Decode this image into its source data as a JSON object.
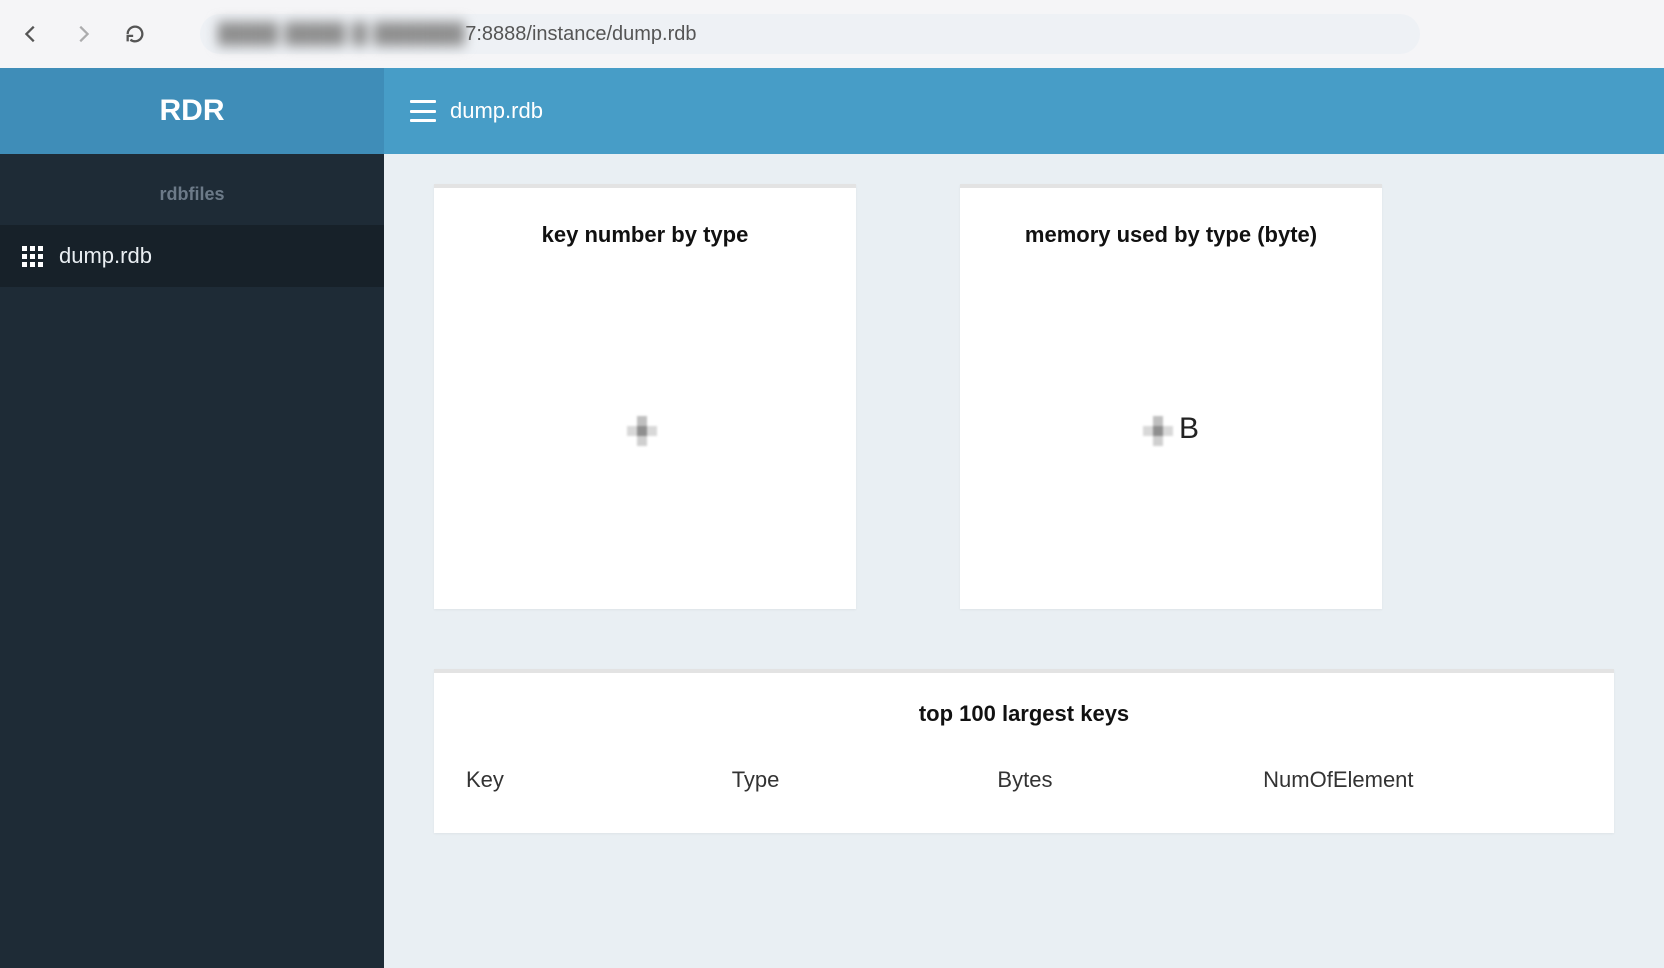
{
  "browser": {
    "url_visible": "7:8888/instance/dump.rdb",
    "url_obscured_prefix": "████ ████ █ ██████"
  },
  "brand": {
    "title": "RDR"
  },
  "topbar": {
    "current_file": "dump.rdb"
  },
  "sidebar": {
    "section_label": "rdbfiles",
    "items": [
      {
        "label": "dump.rdb"
      }
    ]
  },
  "cards": {
    "key_number": {
      "title": "key number by type",
      "value_suffix": ""
    },
    "memory_used": {
      "title": "memory used by type (byte)",
      "value_suffix": "B"
    }
  },
  "table": {
    "title": "top 100 largest keys",
    "columns": [
      "Key",
      "Type",
      "Bytes",
      "NumOfElement"
    ]
  }
}
